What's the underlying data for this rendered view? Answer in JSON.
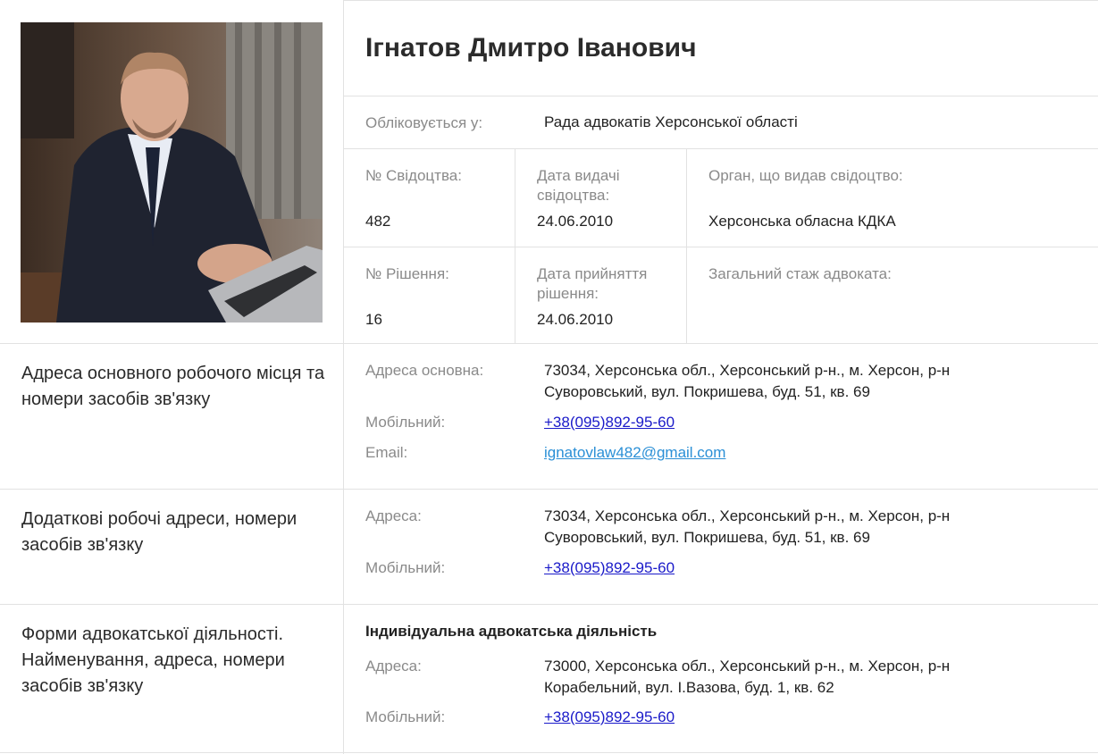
{
  "profile": {
    "name": "Ігнатов Дмитро Іванович",
    "registered_label": "Обліковується у:",
    "registered_value": "Рада адвокатів Херсонської області"
  },
  "certificate": {
    "number_label": "№ Свідоцтва:",
    "number_value": "482",
    "issue_date_label": "Дата видачі свідоцтва:",
    "issue_date_value": "24.06.2010",
    "issuer_label": "Орган, що видав свідоцтво:",
    "issuer_value": "Херсонська обласна КДКА"
  },
  "decision": {
    "number_label": "№ Рішення:",
    "number_value": "16",
    "date_label": "Дата прийняття рішення:",
    "date_value": "24.06.2010",
    "experience_label": "Загальний стаж адвоката:",
    "experience_value": ""
  },
  "primary_contacts": {
    "section_title": "Адреса основного робочого місця та номери засобів зв'язку",
    "address_label": "Адреса основна:",
    "address_value": "73034, Херсонська обл., Херсонський р-н., м. Херсон, р-н Суворовський, вул. Покришева, буд. 51, кв. 69",
    "mobile_label": "Мобільний:",
    "mobile_value": "+38(095)892-95-60",
    "email_label": "Email:",
    "email_value": "ignatovlaw482@gmail.com"
  },
  "additional_contacts": {
    "section_title": "Додаткові робочі адреси, номери засобів зв'язку",
    "address_label": "Адреса:",
    "address_value": "73034, Херсонська обл., Херсонський р-н., м. Херсон, р-н Суворовський, вул. Покришева, буд. 51, кв. 69",
    "mobile_label": "Мобільний:",
    "mobile_value": "+38(095)892-95-60"
  },
  "practice_forms": {
    "section_title": "Форми адвокатської діяльності. Найменування, адреса, номери засобів зв'язку",
    "form_name": "Індивідуальна адвокатська діяльність",
    "address_label": "Адреса:",
    "address_value": "73000, Херсонська обл., Херсонський р-н., м. Херсон, р-н Корабельний, вул. І.Вазова, буд. 1, кв. 62",
    "mobile_label": "Мобільний:",
    "mobile_value": "+38(095)892-95-60"
  }
}
